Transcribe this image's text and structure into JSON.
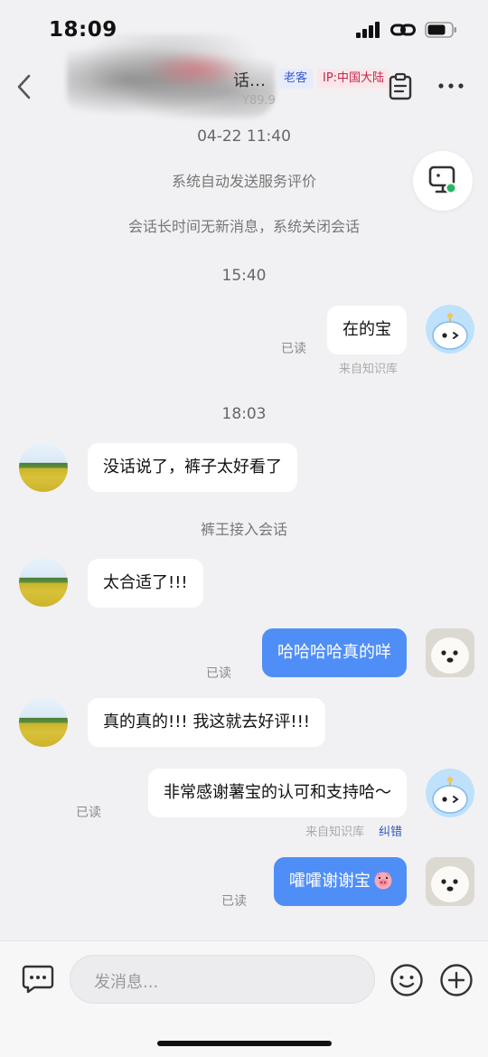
{
  "status": {
    "time": "18:09"
  },
  "header": {
    "title": "话…",
    "subtitle": "Y89.9",
    "badge_old": "老客",
    "badge_ip": "IP:中国大陆"
  },
  "messages": {
    "date_stamp": "04-22 11:40",
    "system_eval": "系统自动发送服务评价",
    "system_close": "会话长时间无新消息，系统关闭会话",
    "time_1540": "15:40",
    "m1_text": "在的宝",
    "m1_read": "已读",
    "m1_from": "来自知识库",
    "time_1803": "18:03",
    "m2_text": "没话说了，裤子太好看了",
    "agent_join": "裤王接入会话",
    "m3_text": "太合适了!!!",
    "m4_text": "哈哈哈哈真的咩",
    "m4_read": "已读",
    "m5_text": "真的真的!!! 我这就去好评!!!",
    "m6_text": "非常感谢薯宝的认可和支持哈～",
    "m6_read": "已读",
    "m6_from": "来自知识库",
    "m6_fix": "纠错",
    "m7_text": "嚯嚯谢谢宝",
    "m7_read": "已读"
  },
  "composer": {
    "placeholder": "发消息..."
  },
  "colors": {
    "accent_blue": "#4f8ef7",
    "ip_red": "#c6244a",
    "old_blue": "#3a5bd0"
  }
}
